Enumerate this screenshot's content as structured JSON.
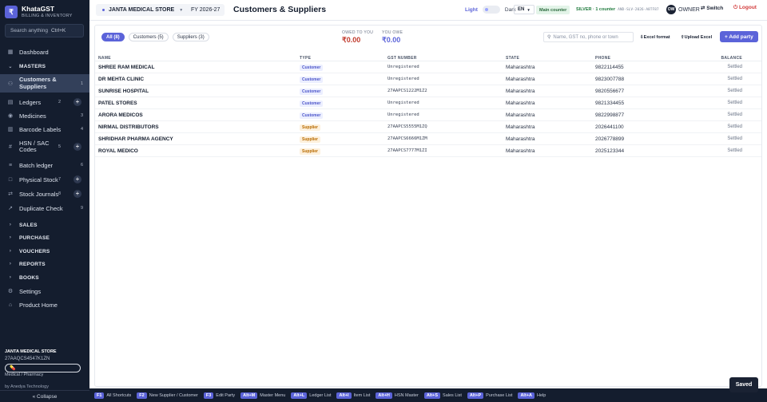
{
  "app": {
    "name": "KhataGST",
    "subtitle": "BILLING & INVENTORY",
    "logo_glyph": "₹"
  },
  "sidebar": {
    "search_placeholder": "Search anything",
    "search_shortcut": "Ctrl+K",
    "items": [
      {
        "label": "Dashboard",
        "icon": "grid-icon"
      },
      {
        "label": "MASTERS",
        "icon": "chevron-down-icon",
        "section": true
      },
      {
        "label": "Customers & Suppliers",
        "count": "1",
        "icon": "users-icon",
        "active": true
      },
      {
        "label": "Ledgers",
        "count": "2",
        "plus": true,
        "icon": "book-icon"
      },
      {
        "label": "Medicines",
        "count": "3",
        "icon": "pill-icon"
      },
      {
        "label": "Barcode Labels",
        "count": "4",
        "icon": "barcode-icon"
      },
      {
        "label": "HSN / SAC Codes",
        "count": "5",
        "plus": true,
        "icon": "hash-icon"
      },
      {
        "label": "Batch ledger",
        "count": "6",
        "icon": "layers-icon"
      },
      {
        "label": "Physical Stock",
        "count": "7",
        "plus": true,
        "icon": "box-icon"
      },
      {
        "label": "Stock Journals",
        "count": "8",
        "plus": true,
        "icon": "journal-icon"
      },
      {
        "label": "Duplicate Check",
        "count": "9",
        "icon": "check-icon"
      },
      {
        "label": "SALES",
        "icon": "chevron-right-icon",
        "section": true
      },
      {
        "label": "PURCHASE",
        "icon": "chevron-right-icon",
        "section": true
      },
      {
        "label": "VOUCHERS",
        "icon": "chevron-right-icon",
        "section": true
      },
      {
        "label": "REPORTS",
        "icon": "chevron-right-icon",
        "section": true
      },
      {
        "label": "BOOKS",
        "icon": "chevron-right-icon",
        "section": true
      },
      {
        "label": "Settings",
        "icon": "gear-icon"
      },
      {
        "label": "Product Home",
        "icon": "home-icon"
      }
    ],
    "footer": {
      "store_name": "JANTA MEDICAL STORE",
      "gstin": "27AAQCS4547K1ZN",
      "business_type": "Medical / Pharmacy",
      "by": "by Anedya Technology",
      "collapse_label": "« Collapse"
    }
  },
  "topbar": {
    "store": "JANTA MEDICAL STORE",
    "fy": "FY 2026-27",
    "page_title": "Customers & Suppliers",
    "theme_light": "Light",
    "theme_dark": "Dark",
    "language": "EN",
    "counter": "Main counter",
    "plan": "SILVER · 1 counter",
    "plan_code": "AND-SLV-2026-A8TF87",
    "owner_initials": "OW",
    "owner_label": "OWNER",
    "switch_label": "Switch",
    "logout_label": "Logout"
  },
  "filters": {
    "pills": [
      {
        "label": "All (8)",
        "active": true
      },
      {
        "label": "Customers (5)",
        "active": false
      },
      {
        "label": "Suppliers (3)",
        "active": false
      }
    ],
    "owed_to_you_label": "OWED TO YOU",
    "owed_to_you_value": "₹0.00",
    "you_owe_label": "YOU OWE",
    "you_owe_value": "₹0.00",
    "search_placeholder": "Name, GST no, phone or town",
    "excel_format_label": "Excel format",
    "upload_excel_label": "Upload Excel",
    "add_party_label": "+ Add party"
  },
  "table": {
    "headers": {
      "name": "NAME",
      "type": "TYPE",
      "gst": "GST NUMBER",
      "state": "STATE",
      "phone": "PHONE",
      "balance": "BALANCE"
    },
    "rows": [
      {
        "name": "SHREE RAM MEDICAL",
        "type": "Customer",
        "gst": "Unregistered",
        "state": "Maharashtra",
        "phone": "9822114455",
        "balance": "Settled"
      },
      {
        "name": "DR MEHTA CLINIC",
        "type": "Customer",
        "gst": "Unregistered",
        "state": "Maharashtra",
        "phone": "9823007788",
        "balance": "Settled"
      },
      {
        "name": "SUNRISE HOSPITAL",
        "type": "Customer",
        "gst": "27AAPCS1222M1Z2",
        "state": "Maharashtra",
        "phone": "9820556677",
        "balance": "Settled"
      },
      {
        "name": "PATEL STORES",
        "type": "Customer",
        "gst": "Unregistered",
        "state": "Maharashtra",
        "phone": "9821334455",
        "balance": "Settled"
      },
      {
        "name": "ARORA MEDICOS",
        "type": "Customer",
        "gst": "Unregistered",
        "state": "Maharashtra",
        "phone": "9822998877",
        "balance": "Settled"
      },
      {
        "name": "NIRMAL DISTRIBUTORS",
        "type": "Supplier",
        "gst": "27AAPCS5555M1ZQ",
        "state": "Maharashtra",
        "phone": "2026441100",
        "balance": "Settled"
      },
      {
        "name": "SHRIDHAR PHARMA AGENCY",
        "type": "Supplier",
        "gst": "27AAPCS6666M1ZM",
        "state": "Maharashtra",
        "phone": "2026778899",
        "balance": "Settled"
      },
      {
        "name": "ROYAL MEDICO",
        "type": "Supplier",
        "gst": "27AAPCS7777M1ZI",
        "state": "Maharashtra",
        "phone": "2025123344",
        "balance": "Settled"
      }
    ]
  },
  "shortcuts": [
    {
      "key": "F1",
      "label": "All Shortcuts"
    },
    {
      "key": "F2",
      "label": "New Supplier / Customer"
    },
    {
      "key": "F3",
      "label": "Edit Party"
    },
    {
      "key": "Alt+M",
      "label": "Master Menu"
    },
    {
      "key": "Alt+L",
      "label": "Ledger List"
    },
    {
      "key": "Alt+I",
      "label": "Item List"
    },
    {
      "key": "Alt+H",
      "label": "HSN Master"
    },
    {
      "key": "Alt+S",
      "label": "Sales List"
    },
    {
      "key": "Alt+P",
      "label": "Purchase List"
    },
    {
      "key": "Alt+A",
      "label": "Help"
    }
  ],
  "toast": "Saved",
  "colors": {
    "accent": "#5b63d9",
    "sidebar_bg": "#141d2e",
    "danger": "#d23b3b",
    "owed": "#c0392b"
  }
}
